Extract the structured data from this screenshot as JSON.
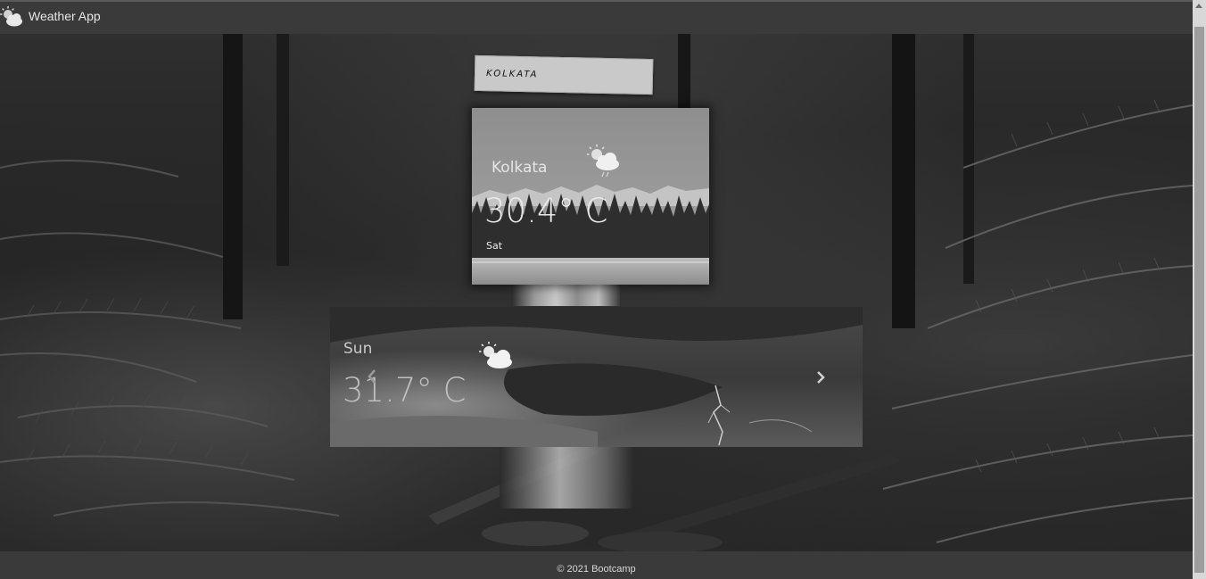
{
  "navbar": {
    "brand_icon": "partly-cloudy-icon",
    "brand_label": "Weather App"
  },
  "search": {
    "value": "KOLKATA"
  },
  "current": {
    "city": "Kolkata",
    "icon": "rain-cloud-sun-icon",
    "temperature": "30.4° C",
    "day": "Sat"
  },
  "forecast": {
    "day": "Sun",
    "icon": "partly-cloudy-icon",
    "temperature": "31.7° C",
    "prev_icon": "chevron-left-icon",
    "next_icon": "chevron-right-icon"
  },
  "footer": {
    "text": "© 2021 Bootcamp"
  }
}
